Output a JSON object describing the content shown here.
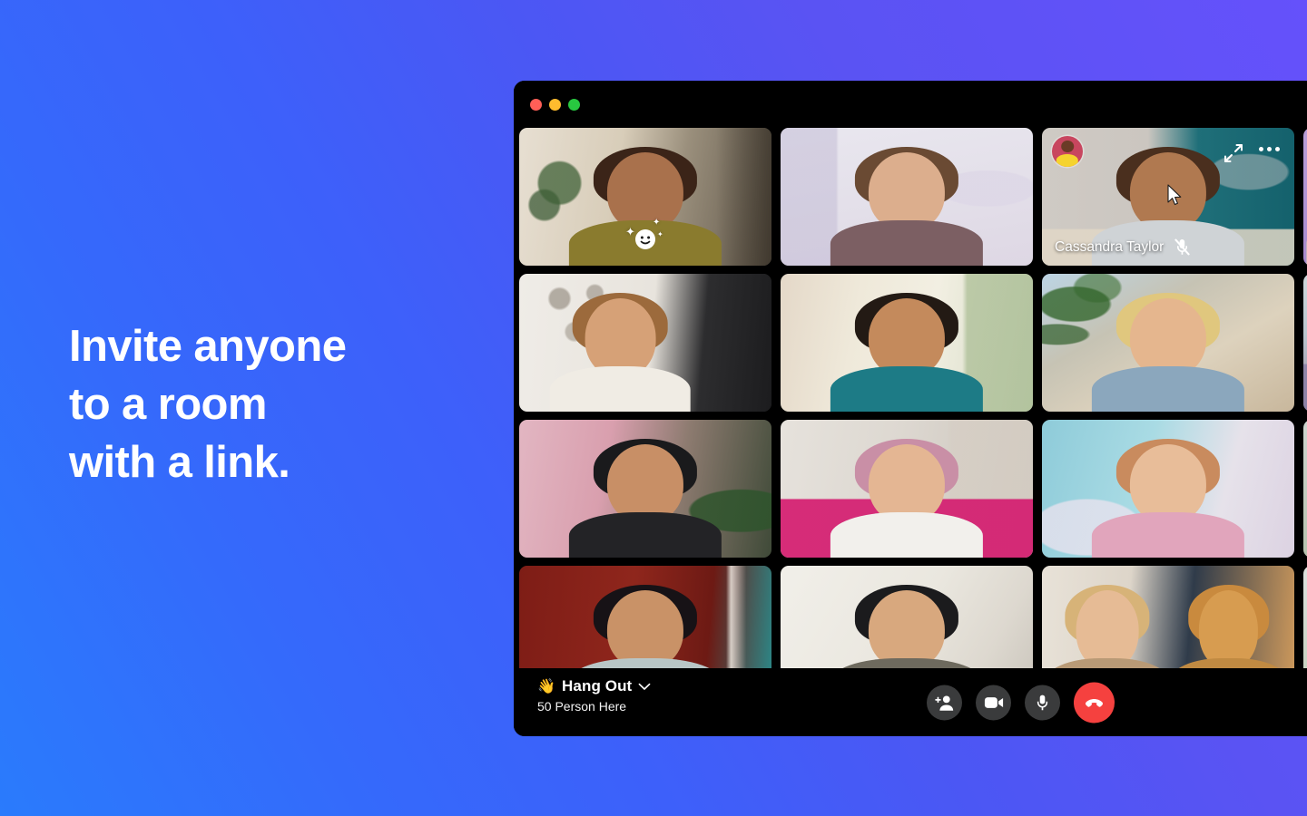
{
  "background": {
    "gradient_from": "#2a7bfc",
    "gradient_to": "#6551fb"
  },
  "marketing": {
    "headline": "Invite anyone\nto a room\nwith a link."
  },
  "window": {
    "traffic_lights": [
      {
        "name": "close",
        "color": "#ff5f57"
      },
      {
        "name": "minimize",
        "color": "#febc2e"
      },
      {
        "name": "zoom",
        "color": "#28c840"
      }
    ]
  },
  "grid": {
    "columns": 4,
    "rows": 4,
    "tiles": [
      {
        "id": 1,
        "label": "",
        "hovered": false,
        "reaction": "smiley",
        "scene": "living-room"
      },
      {
        "id": 2,
        "label": "",
        "hovered": false,
        "reaction": "",
        "scene": "bedroom-wall"
      },
      {
        "id": 3,
        "label": "Cassandra Taylor",
        "hovered": true,
        "reaction": "",
        "scene": "teal-room",
        "muted": true
      },
      {
        "id": 4,
        "label": "",
        "hovered": false,
        "reaction": "",
        "scene": "purple-wall"
      },
      {
        "id": 5,
        "label": "",
        "hovered": false,
        "reaction": "",
        "scene": "gallery-wall"
      },
      {
        "id": 6,
        "label": "",
        "hovered": false,
        "reaction": "",
        "scene": "bright-studio"
      },
      {
        "id": 7,
        "label": "",
        "hovered": false,
        "reaction": "",
        "scene": "palm-patio"
      },
      {
        "id": 8,
        "label": "",
        "hovered": false,
        "reaction": "",
        "scene": "poolside"
      },
      {
        "id": 9,
        "label": "",
        "hovered": false,
        "reaction": "",
        "scene": "pink-curtain"
      },
      {
        "id": 10,
        "label": "",
        "hovered": false,
        "reaction": "",
        "scene": "magenta-couch"
      },
      {
        "id": 11,
        "label": "",
        "hovered": false,
        "reaction": "",
        "scene": "blue-bedroom"
      },
      {
        "id": 12,
        "label": "",
        "hovered": false,
        "reaction": "",
        "scene": "garden"
      },
      {
        "id": 13,
        "label": "",
        "hovered": false,
        "reaction": "",
        "scene": "red-booth"
      },
      {
        "id": 14,
        "label": "",
        "hovered": false,
        "reaction": "",
        "scene": "white-bedroom"
      },
      {
        "id": 15,
        "label": "",
        "hovered": false,
        "reaction": "",
        "scene": "desk-with-dog"
      },
      {
        "id": 16,
        "label": "",
        "hovered": false,
        "reaction": "",
        "scene": "plants"
      }
    ]
  },
  "hovered_tile_controls": {
    "expand_icon": "expand-arrows-icon",
    "more_icon": "more-options-icon",
    "avatar": "participant-avatar",
    "mute_icon": "microphone-muted-icon",
    "cursor": "mouse-cursor"
  },
  "toolbar": {
    "room_emoji": "👋",
    "room_name": "Hang Out",
    "chevron": "chevron-down-icon",
    "participant_count": "50 Person Here",
    "controls": [
      {
        "name": "add-person-button",
        "icon": "person-add-icon",
        "style": "dark"
      },
      {
        "name": "video-toggle-button",
        "icon": "video-camera-icon",
        "style": "dark"
      },
      {
        "name": "microphone-toggle-button",
        "icon": "microphone-icon",
        "style": "dark"
      },
      {
        "name": "end-call-button",
        "icon": "phone-hangup-icon",
        "style": "danger",
        "color": "#f5413f"
      }
    ]
  }
}
